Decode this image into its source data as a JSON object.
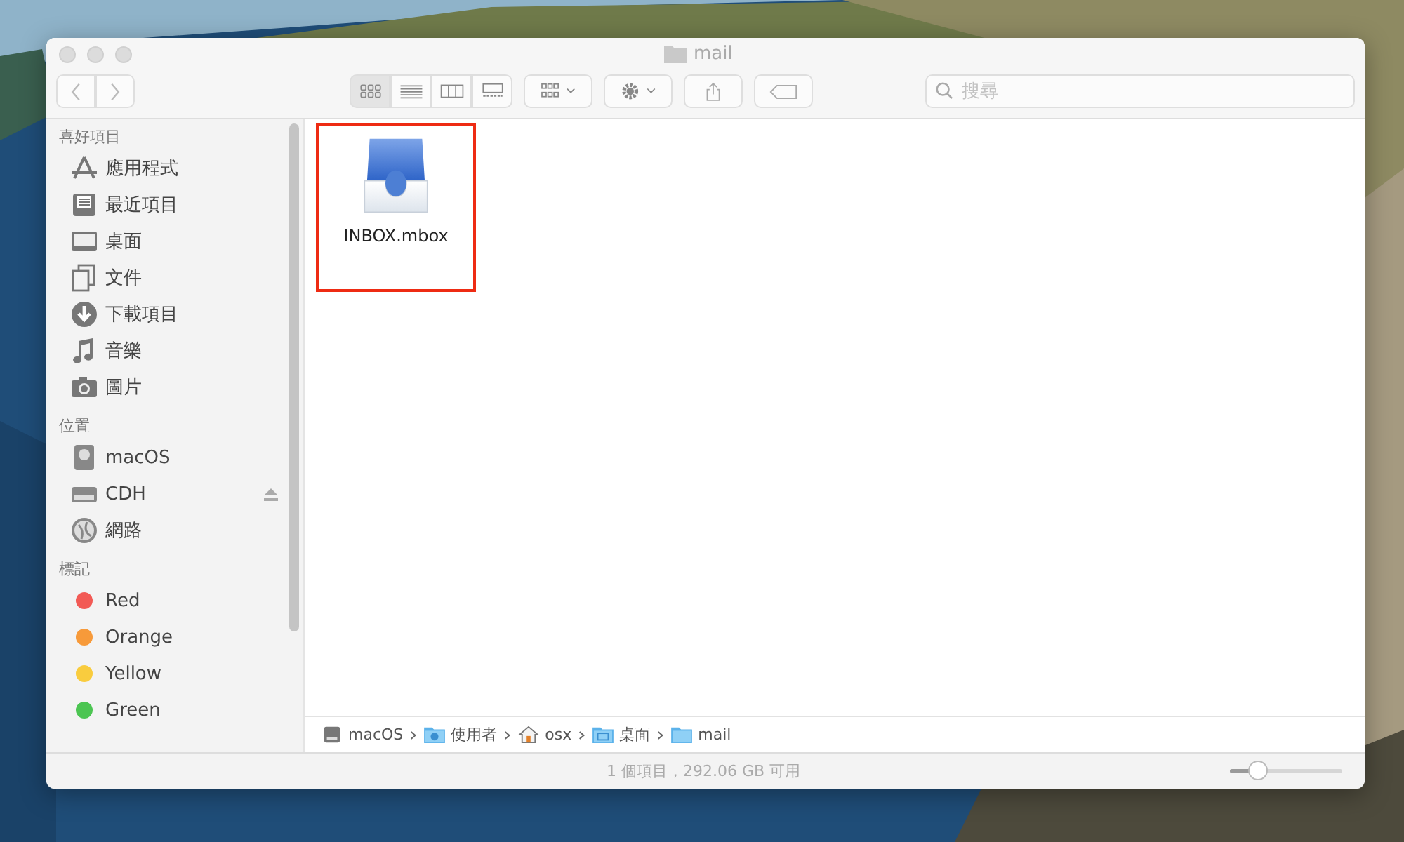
{
  "window": {
    "title": "mail"
  },
  "toolbar": {
    "view_modes": [
      {
        "kind": "icons",
        "selected": true
      },
      {
        "kind": "list",
        "selected": false
      },
      {
        "kind": "columns",
        "selected": false
      },
      {
        "kind": "gallery",
        "selected": false
      }
    ]
  },
  "search": {
    "placeholder": "搜尋"
  },
  "sidebar": {
    "sections": [
      {
        "title": "喜好項目",
        "items": [
          {
            "label": "應用程式",
            "kind": "apps"
          },
          {
            "label": "最近項目",
            "kind": "recents"
          },
          {
            "label": "桌面",
            "kind": "desktop"
          },
          {
            "label": "文件",
            "kind": "documents"
          },
          {
            "label": "下載項目",
            "kind": "downloads"
          },
          {
            "label": "音樂",
            "kind": "music"
          },
          {
            "label": "圖片",
            "kind": "pictures"
          }
        ]
      },
      {
        "title": "位置",
        "items": [
          {
            "label": "macOS",
            "kind": "disk",
            "eject": false
          },
          {
            "label": "CDH",
            "kind": "drive",
            "eject": true
          },
          {
            "label": "網路",
            "kind": "network",
            "eject": false
          }
        ]
      },
      {
        "title": "標記",
        "items": [
          {
            "label": "Red",
            "kind": "tag",
            "color": "#f25a55"
          },
          {
            "label": "Orange",
            "kind": "tag",
            "color": "#f79a3a"
          },
          {
            "label": "Yellow",
            "kind": "tag",
            "color": "#f9cc3e"
          },
          {
            "label": "Green",
            "kind": "tag",
            "color": "#4cc552"
          }
        ]
      }
    ]
  },
  "files": [
    {
      "name": "INBOX.mbox",
      "highlighted": true
    }
  ],
  "path_bar": [
    {
      "label": "macOS",
      "kind": "disk"
    },
    {
      "label": "使用者",
      "kind": "users"
    },
    {
      "label": "osx",
      "kind": "home"
    },
    {
      "label": "桌面",
      "kind": "folder-desktop"
    },
    {
      "label": "mail",
      "kind": "folder"
    }
  ],
  "status_bar": {
    "text": "1 個項目，292.06 GB 可用",
    "icon_size": {
      "level": 0.25
    }
  }
}
